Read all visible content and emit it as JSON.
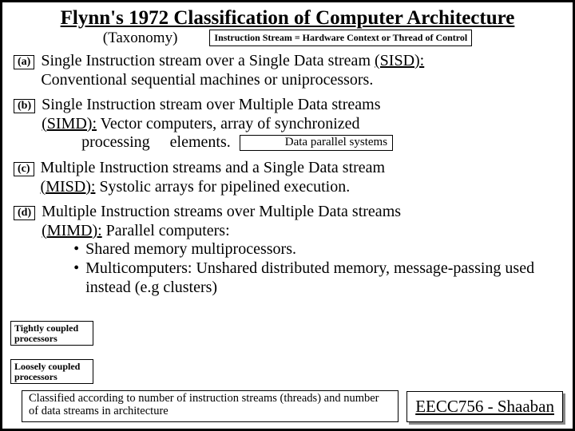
{
  "title": "Flynn's 1972 Classification of Computer Architecture",
  "subtitle": "(Taxonomy)",
  "header_note": "Instruction Stream = Hardware Context or Thread of Control",
  "items": {
    "a": {
      "label": "(a)",
      "line1a": "Single Instruction stream over a Single Data stream ",
      "line1b": "(SISD):",
      "line2": "Conventional sequential machines or uniprocessors."
    },
    "b": {
      "label": "(b)",
      "line1": "Single Instruction stream over Multiple Data streams",
      "line2a": "(SIMD):",
      "line2b": "  Vector computers, array of synchronized",
      "line3a": "processing",
      "line3b": "elements.",
      "inline": "Data parallel systems"
    },
    "c": {
      "label": "(c)",
      "line1": "Multiple Instruction streams and a Single Data stream",
      "line2a": "(MISD):",
      "line2b": "  Systolic arrays for pipelined execution."
    },
    "d": {
      "label": "(d)",
      "line1": "Multiple Instruction streams over Multiple Data streams",
      "line2a": "(MIMD):",
      "line2b": "  Parallel computers:",
      "bullet1": "Shared memory multiprocessors.",
      "bullet2": "Multicomputers:  Unshared distributed memory, message-passing used instead (e.g clusters)"
    }
  },
  "side": {
    "tight": "Tightly coupled processors",
    "loose": "Loosely coupled processors"
  },
  "footer_note": "Classified according to number of instruction streams (threads) and number of data streams in architecture",
  "course": "EECC756 - Shaaban"
}
